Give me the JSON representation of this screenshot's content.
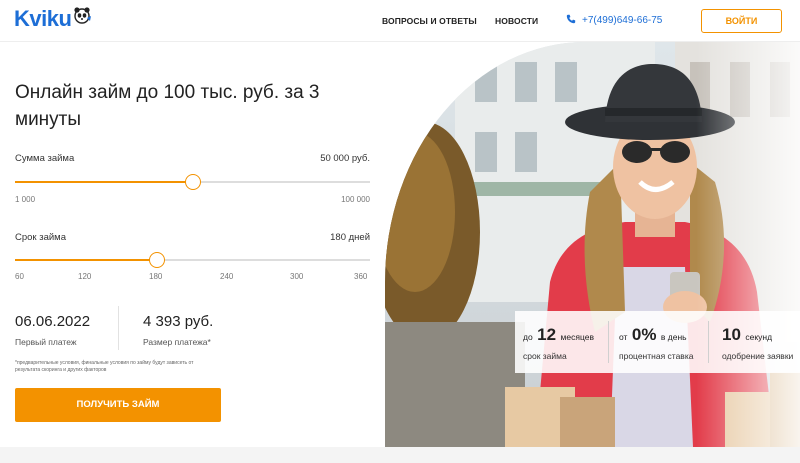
{
  "header": {
    "logo_text": "Kviku",
    "nav": [
      {
        "label": "ВОПРОСЫ И ОТВЕТЫ"
      },
      {
        "label": "НОВОСТИ"
      }
    ],
    "phone": "+7(499)649-66-75",
    "login_label": "ВОЙТИ"
  },
  "hero": {
    "title": "Онлайн займ до 100 тыс. руб. за 3 минуты"
  },
  "amount": {
    "label": "Сумма займа",
    "value": "50 000 руб.",
    "min_label": "1 000",
    "max_label": "100 000",
    "slider_fraction": 0.5
  },
  "term": {
    "label": "Срок займа",
    "value": "180 дней",
    "ticks": [
      "60",
      "120",
      "180",
      "240",
      "300",
      "360"
    ],
    "slider_fraction": 0.4
  },
  "result": {
    "date_value": "06.06.2022",
    "date_label": "Первый платеж",
    "payment_value": "4 393 руб.",
    "payment_label": "Размер платежа*"
  },
  "footnote": "*предварительные условия, финальные условия по займу будут зависеть от результата скоринга и других факторов",
  "cta_label": "ПОЛУЧИТЬ ЗАЙМ",
  "stats": [
    {
      "prefix": "до",
      "number": "12",
      "suffix": "месяцев",
      "label": "срок займа"
    },
    {
      "prefix": "от",
      "number": "0%",
      "suffix": "в день",
      "label": "процентная ставка"
    },
    {
      "prefix": "",
      "number": "10",
      "suffix": "секунд",
      "label": "одобрение заявки"
    }
  ],
  "colors": {
    "accent": "#f39200",
    "brand_blue": "#1d6ed6"
  },
  "icons": {
    "phone": "phone-icon",
    "logo_mascot": "panda-icon"
  }
}
